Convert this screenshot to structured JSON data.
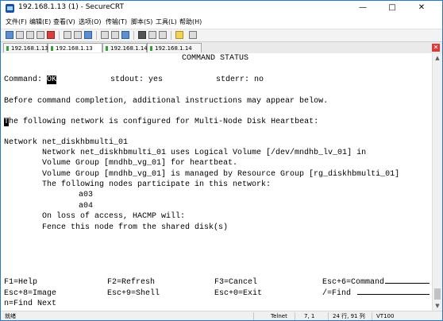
{
  "window": {
    "title": "192.168.1.13 (1) - SecureCRT"
  },
  "menu": [
    "文件(F)",
    "编辑(E)",
    "查看(V)",
    "选项(O)",
    "传输(T)",
    "脚本(S)",
    "工具(L)",
    "帮助(H)"
  ],
  "tabs": [
    "192.168.1.13",
    "192.168.1.13 (1)",
    "192.168.1.14",
    "192.168.1.14 (1)"
  ],
  "terminal": {
    "header": "COMMAND STATUS",
    "command_label": "Command:",
    "command_value": "OK",
    "stdout": "stdout: yes",
    "stderr": "stderr: no",
    "notice": "Before command completion, additional instructions may appear below.",
    "line1_first": "T",
    "line1_rest": "he following network is configured for Multi-Node Disk Heartbeat:",
    "net": "Network net_diskhbmulti_01",
    "l1": "Network net_diskhbmulti_01 uses Logical Volume [/dev/mndhb_lv_01] in",
    "l2": "Volume Group [mndhb_vg_01] for heartbeat.",
    "l3": "Volume Group [mndhb_vg_01] is managed by Resource Group [rg_diskhbmulti_01]",
    "l4": "The following nodes participate in this network:",
    "node1": "a03",
    "node2": "a04",
    "l5": "On loss of access, HACMP will:",
    "l6": "Fence this node from the shared disk(s)",
    "fkeys": {
      "f1": "F1=Help",
      "f2": "F2=Refresh",
      "f3": "F3=Cancel",
      "esc6": "Esc+6=Command",
      "esc8": "Esc+8=Image",
      "esc9": "Esc+9=Shell",
      "esc0": "Esc+0=Exit",
      "find": "/=Find",
      "findnext": "n=Find Next"
    }
  },
  "status": {
    "ready": "就绪",
    "protocol": "Telnet",
    "position": "7,   1",
    "size": "24 行, 91 列",
    "emulation": "VT100"
  }
}
